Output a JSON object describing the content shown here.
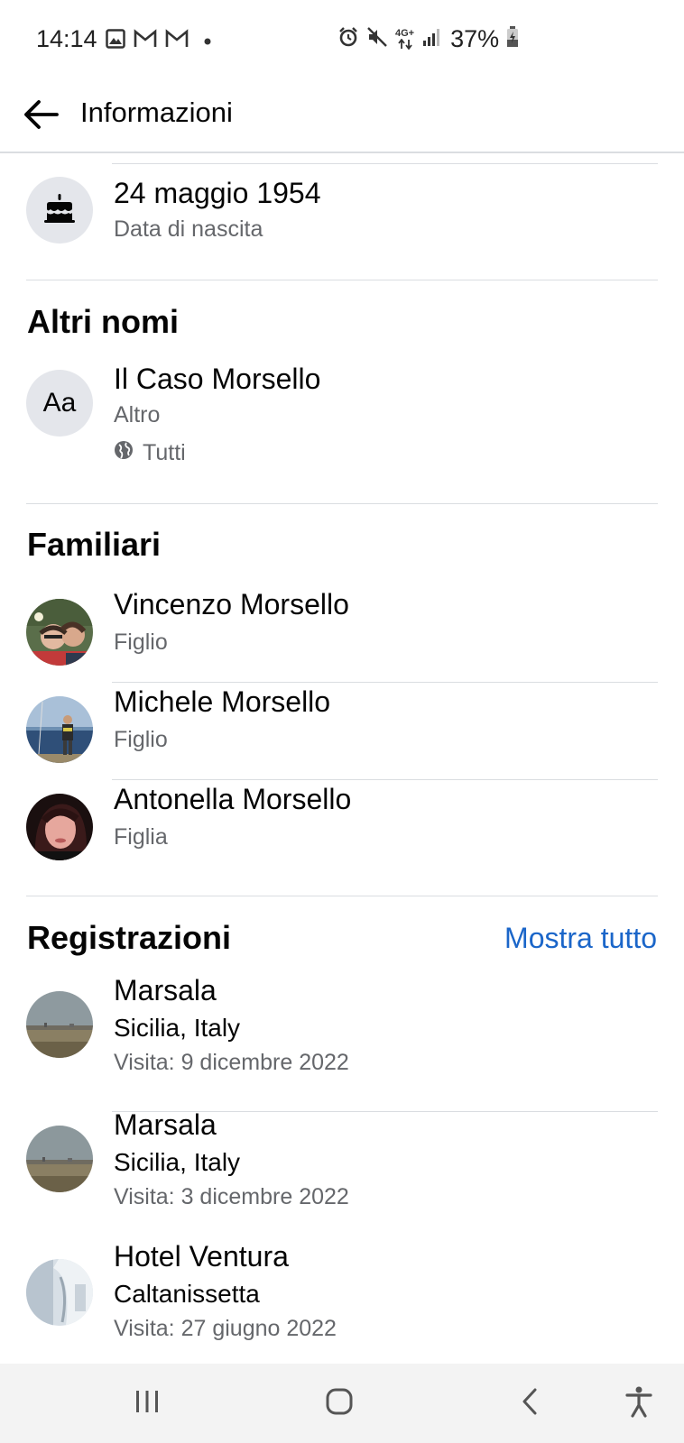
{
  "status_bar": {
    "time": "14:14",
    "battery": "37%",
    "left_icons": [
      "image-icon",
      "gmail-icon",
      "gmail-icon",
      "dot-icon"
    ],
    "right_icons": [
      "alarm-icon",
      "mute-icon",
      "4g-data-icon",
      "signal-icon",
      "battery-icon"
    ],
    "network_label": "4G+"
  },
  "header": {
    "back_icon": "arrow-left-icon",
    "title": "Informazioni"
  },
  "birthday": {
    "icon": "cake-icon",
    "date": "24 maggio 1954",
    "label": "Data di nascita"
  },
  "other_names": {
    "title": "Altri nomi",
    "icon_text": "Aa",
    "name": "Il Caso Morsello",
    "type": "Altro",
    "audience": "Tutti",
    "audience_icon": "globe-icon"
  },
  "family": {
    "title": "Familiari",
    "members": [
      {
        "name": "Vincenzo Morsello",
        "relation": "Figlio"
      },
      {
        "name": "Michele Morsello",
        "relation": "Figlio"
      },
      {
        "name": "Antonella Morsello",
        "relation": "Figlia"
      }
    ]
  },
  "checkins": {
    "title": "Registrazioni",
    "see_all": "Mostra tutto",
    "items": [
      {
        "place": "Marsala",
        "location": "Sicilia, Italy",
        "visit": "Visita: 9 dicembre 2022"
      },
      {
        "place": "Marsala",
        "location": "Sicilia, Italy",
        "visit": "Visita: 3 dicembre 2022"
      },
      {
        "place": "Hotel Ventura",
        "location": "Caltanissetta",
        "visit": "Visita: 27 giugno 2022"
      }
    ]
  },
  "nav_bar": {
    "icons": [
      "recent-apps-icon",
      "home-icon",
      "back-nav-icon",
      "accessibility-icon"
    ]
  },
  "colors": {
    "link": "#1b66c9",
    "secondary_text": "#65676b",
    "divider": "#dadde1",
    "icon_bg": "#e4e6eb"
  }
}
